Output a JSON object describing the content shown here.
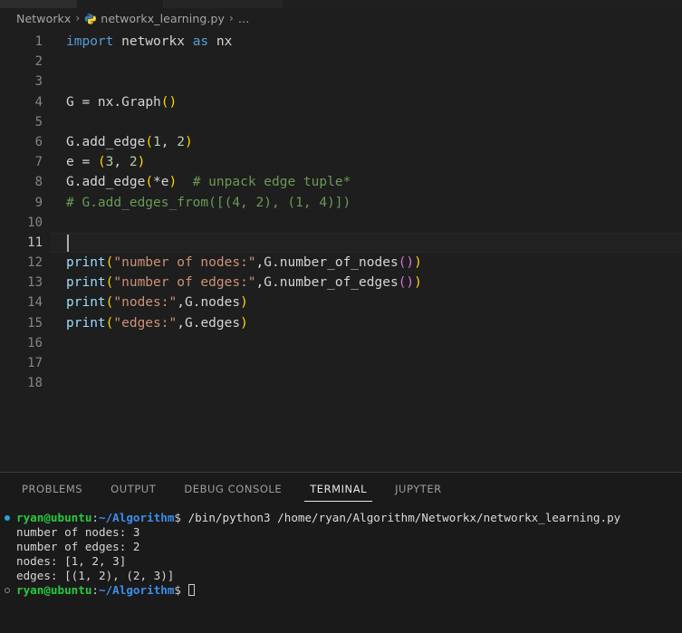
{
  "breadcrumb": {
    "folder": "Networkx",
    "file": "networkx_learning.py",
    "separator": "›",
    "overflow": "…",
    "file_icon": "python-logo-icon"
  },
  "editor": {
    "language": "python",
    "active_line": 11,
    "lines": [
      {
        "num": "1",
        "tokens": [
          {
            "t": "import",
            "c": "t-kw"
          },
          {
            "t": " networkx ",
            "c": "t-id"
          },
          {
            "t": "as",
            "c": "t-kw"
          },
          {
            "t": " nx",
            "c": "t-id"
          }
        ]
      },
      {
        "num": "2",
        "tokens": []
      },
      {
        "num": "3",
        "tokens": []
      },
      {
        "num": "4",
        "tokens": [
          {
            "t": "G ",
            "c": "t-id"
          },
          {
            "t": "=",
            "c": "t-op"
          },
          {
            "t": " nx",
            "c": "t-id"
          },
          {
            "t": ".",
            "c": "t-op"
          },
          {
            "t": "Graph",
            "c": "t-id"
          },
          {
            "t": "()",
            "c": "t-p1"
          }
        ]
      },
      {
        "num": "5",
        "tokens": []
      },
      {
        "num": "6",
        "tokens": [
          {
            "t": "G",
            "c": "t-id"
          },
          {
            "t": ".",
            "c": "t-op"
          },
          {
            "t": "add_edge",
            "c": "t-id"
          },
          {
            "t": "(",
            "c": "t-p1"
          },
          {
            "t": "1",
            "c": "t-num"
          },
          {
            "t": ", ",
            "c": "t-op"
          },
          {
            "t": "2",
            "c": "t-num"
          },
          {
            "t": ")",
            "c": "t-p1"
          }
        ]
      },
      {
        "num": "7",
        "tokens": [
          {
            "t": "e ",
            "c": "t-id"
          },
          {
            "t": "=",
            "c": "t-op"
          },
          {
            "t": " ",
            "c": "t-op"
          },
          {
            "t": "(",
            "c": "t-p1"
          },
          {
            "t": "3",
            "c": "t-num"
          },
          {
            "t": ", ",
            "c": "t-op"
          },
          {
            "t": "2",
            "c": "t-num"
          },
          {
            "t": ")",
            "c": "t-p1"
          }
        ]
      },
      {
        "num": "8",
        "tokens": [
          {
            "t": "G",
            "c": "t-id"
          },
          {
            "t": ".",
            "c": "t-op"
          },
          {
            "t": "add_edge",
            "c": "t-id"
          },
          {
            "t": "(",
            "c": "t-p1"
          },
          {
            "t": "*",
            "c": "t-op"
          },
          {
            "t": "e",
            "c": "t-id"
          },
          {
            "t": ")",
            "c": "t-p1"
          },
          {
            "t": "  ",
            "c": "t-op"
          },
          {
            "t": "# unpack edge tuple*",
            "c": "t-com"
          }
        ]
      },
      {
        "num": "9",
        "tokens": [
          {
            "t": "# G.add_edges_from([(4, 2), (1, 4)])",
            "c": "t-com"
          }
        ]
      },
      {
        "num": "10",
        "tokens": []
      },
      {
        "num": "11",
        "tokens": []
      },
      {
        "num": "12",
        "tokens": [
          {
            "t": "print",
            "c": "t-bi"
          },
          {
            "t": "(",
            "c": "t-p1"
          },
          {
            "t": "\"number of nodes:\"",
            "c": "t-str"
          },
          {
            "t": ",",
            "c": "t-op"
          },
          {
            "t": "G",
            "c": "t-id"
          },
          {
            "t": ".",
            "c": "t-op"
          },
          {
            "t": "number_of_nodes",
            "c": "t-id"
          },
          {
            "t": "()",
            "c": "t-p2"
          },
          {
            "t": ")",
            "c": "t-p1"
          }
        ]
      },
      {
        "num": "13",
        "tokens": [
          {
            "t": "print",
            "c": "t-bi"
          },
          {
            "t": "(",
            "c": "t-p1"
          },
          {
            "t": "\"number of edges:\"",
            "c": "t-str"
          },
          {
            "t": ",",
            "c": "t-op"
          },
          {
            "t": "G",
            "c": "t-id"
          },
          {
            "t": ".",
            "c": "t-op"
          },
          {
            "t": "number_of_edges",
            "c": "t-id"
          },
          {
            "t": "()",
            "c": "t-p2"
          },
          {
            "t": ")",
            "c": "t-p1"
          }
        ]
      },
      {
        "num": "14",
        "tokens": [
          {
            "t": "print",
            "c": "t-bi"
          },
          {
            "t": "(",
            "c": "t-p1"
          },
          {
            "t": "\"nodes:\"",
            "c": "t-str"
          },
          {
            "t": ",",
            "c": "t-op"
          },
          {
            "t": "G",
            "c": "t-id"
          },
          {
            "t": ".",
            "c": "t-op"
          },
          {
            "t": "nodes",
            "c": "t-id"
          },
          {
            "t": ")",
            "c": "t-p1"
          }
        ]
      },
      {
        "num": "15",
        "tokens": [
          {
            "t": "print",
            "c": "t-bi"
          },
          {
            "t": "(",
            "c": "t-p1"
          },
          {
            "t": "\"edges:\"",
            "c": "t-str"
          },
          {
            "t": ",",
            "c": "t-op"
          },
          {
            "t": "G",
            "c": "t-id"
          },
          {
            "t": ".",
            "c": "t-op"
          },
          {
            "t": "edges",
            "c": "t-id"
          },
          {
            "t": ")",
            "c": "t-p1"
          }
        ]
      },
      {
        "num": "16",
        "tokens": []
      },
      {
        "num": "17",
        "tokens": []
      },
      {
        "num": "18",
        "tokens": []
      }
    ]
  },
  "panel": {
    "tabs": [
      {
        "label": "PROBLEMS",
        "active": false
      },
      {
        "label": "OUTPUT",
        "active": false
      },
      {
        "label": "DEBUG CONSOLE",
        "active": false
      },
      {
        "label": "TERMINAL",
        "active": true
      },
      {
        "label": "JUPYTER",
        "active": false
      }
    ]
  },
  "terminal": {
    "prompt_user": "ryan@ubuntu",
    "prompt_colon": ":",
    "prompt_path": "~/Algorithm",
    "prompt_dollar": "$",
    "command": " /bin/python3 /home/ryan/Algorithm/Networkx/networkx_learning.py",
    "output": [
      "number of nodes: 3",
      "number of edges: 2",
      "nodes: [1, 2, 3]",
      "edges: [(1, 2), (2, 3)]"
    ]
  },
  "colors": {
    "editor_bg": "#1e1e1e",
    "panel_bg": "#1a1a1a",
    "keyword": "#569cd6",
    "string": "#ce9178",
    "comment": "#6a9955",
    "number": "#b5cea8",
    "builtin": "#9cdcfe",
    "bracket1": "#ffd700",
    "bracket2": "#da70d6",
    "prompt_user": "#27c93f",
    "prompt_path": "#3b8eea",
    "accent": "#2aa2d8"
  }
}
